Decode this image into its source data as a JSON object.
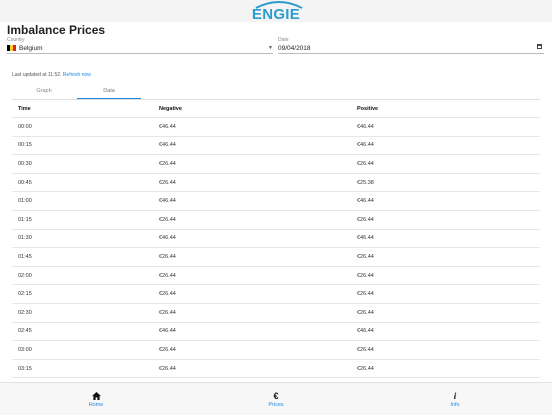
{
  "brand": {
    "logo_text": "ENGIE",
    "logo_color": "#2c9ccf"
  },
  "page": {
    "title": "Imbalance Prices"
  },
  "filters": {
    "country": {
      "label": "Country",
      "value": "Belgium"
    },
    "date": {
      "label": "Date",
      "value": "09/04/2018"
    }
  },
  "status": {
    "last_updated": "Last updated at 11:52.",
    "refresh": "Refresh now"
  },
  "tabs": [
    {
      "label": "Graph",
      "active": false
    },
    {
      "label": "Data",
      "active": true
    }
  ],
  "table": {
    "headers": [
      "Time",
      "Negative",
      "Positive"
    ],
    "rows": [
      [
        "00:00",
        "€46.44",
        "€46.44"
      ],
      [
        "00:15",
        "€46.44",
        "€46.44"
      ],
      [
        "00:30",
        "€26.44",
        "€26.44"
      ],
      [
        "00:45",
        "€26.44",
        "€25.38"
      ],
      [
        "01:00",
        "€46.44",
        "€46.44"
      ],
      [
        "01:15",
        "€26.44",
        "€26.44"
      ],
      [
        "01:30",
        "€46.44",
        "€46.44"
      ],
      [
        "01:45",
        "€26.44",
        "€26.44"
      ],
      [
        "02:00",
        "€26.44",
        "€26.44"
      ],
      [
        "02:15",
        "€26.44",
        "€26.44"
      ],
      [
        "02:30",
        "€26.44",
        "€26.44"
      ],
      [
        "02:45",
        "€46.44",
        "€46.44"
      ],
      [
        "03:00",
        "€26.44",
        "€26.44"
      ],
      [
        "03:15",
        "€26.44",
        "€26.44"
      ]
    ]
  },
  "nav": [
    {
      "icon": "home-icon",
      "label": "Home"
    },
    {
      "icon": "euro-icon",
      "label": "Prices"
    },
    {
      "icon": "info-icon",
      "label": "Info"
    }
  ],
  "colors": {
    "accent": "#1e88e5",
    "flag": [
      "#000000",
      "#f6d21b",
      "#e21e26"
    ]
  }
}
